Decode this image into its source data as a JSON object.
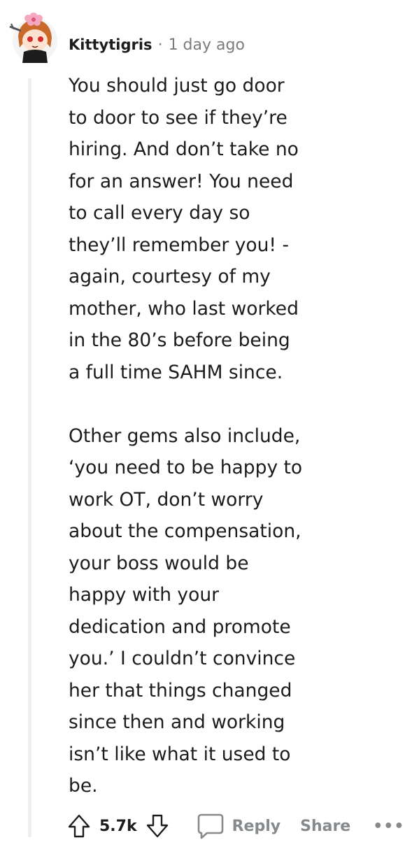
{
  "comment": {
    "username": "Kittytigris",
    "separator": "·",
    "timestamp": "1 day ago",
    "paragraphs": [
      "You should just go door\nto door to see if they’re\nhiring. And don’t take no\nfor an answer! You need\nto call every day so\nthey’ll remember you! -\nagain, courtesy of my\nmother, who last worked\nin the 80’s before being\na full time SAHM since.",
      "Other gems also include,\n‘you need to be happy to\nwork OT, don’t worry\nabout the compensation,\nyour boss would be\nhappy with your\ndedication and promote\nyou.’ I couldn’t convince\nher that things changed\nsince then and working\nisn’t like what it used to\nbe."
    ]
  },
  "actions": {
    "vote_count": "5.7k",
    "reply_label": "Reply",
    "share_label": "Share",
    "more_label": "•••"
  },
  "icons": {
    "avatar": "avatar-icon",
    "upvote": "upvote-arrow-icon",
    "downvote": "downvote-arrow-icon",
    "reply": "speech-bubble-icon"
  },
  "colors": {
    "text": "#1c1c1c",
    "meta": "#7c7c7c",
    "action": "#878a8c",
    "thread_line": "#edeff1"
  }
}
